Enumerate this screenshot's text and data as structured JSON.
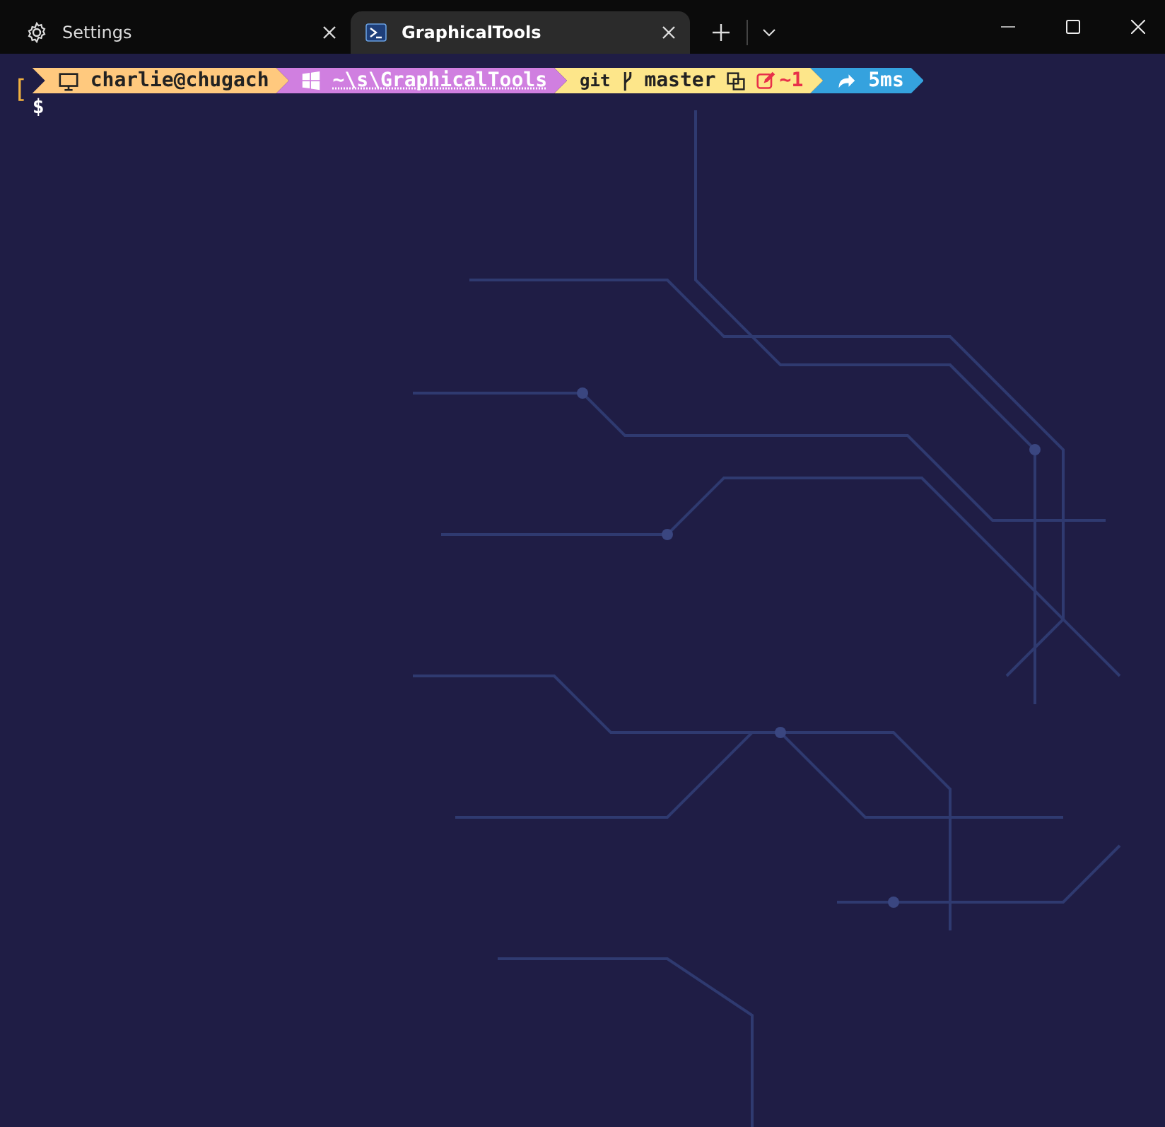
{
  "tabs": [
    {
      "label": "Settings",
      "kind": "settings",
      "selected": false
    },
    {
      "label": "GraphicalTools",
      "kind": "terminal",
      "selected": true
    }
  ],
  "prompt": {
    "bracket": "[",
    "segments": [
      {
        "kind": "user",
        "color": "#ffc97e",
        "text": "charlie@chugach"
      },
      {
        "kind": "path",
        "color": "#d07fe0",
        "text": "~\\s\\GraphicalTools"
      },
      {
        "kind": "git",
        "color": "#fde68a",
        "label": "git",
        "branch": "master",
        "changes": "~1"
      },
      {
        "kind": "time",
        "color": "#35a2de",
        "text": "5ms"
      }
    ],
    "symbol": "$"
  }
}
